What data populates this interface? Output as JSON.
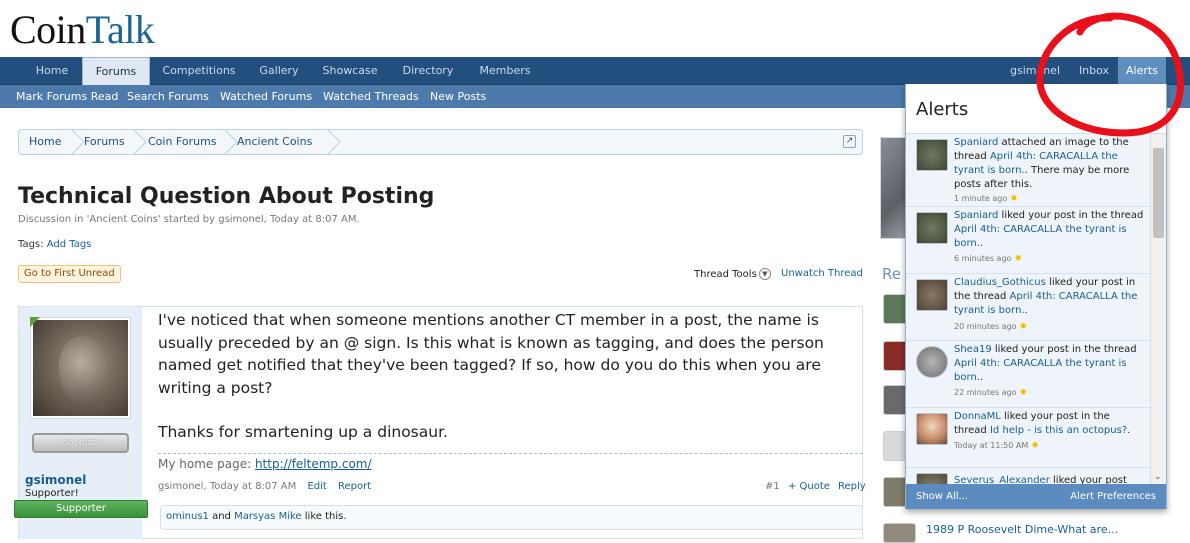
{
  "logo": {
    "part1": "Coin",
    "part2": "Talk"
  },
  "nav": {
    "tabs": [
      "Home",
      "Forums",
      "Competitions",
      "Gallery",
      "Showcase",
      "Directory",
      "Members"
    ],
    "user": "gsimonel",
    "inbox": "Inbox",
    "alerts": "Alerts"
  },
  "subnav": [
    "Mark Forums Read",
    "Search Forums",
    "Watched Forums",
    "Watched Threads",
    "New Posts"
  ],
  "breadcrumb": [
    "Home",
    "Forums",
    "Coin Forums",
    "Ancient Coins"
  ],
  "thread": {
    "title": "Technical Question About Posting",
    "description": "Discussion in 'Ancient Coins' started by gsimonel, Today at 8:07 AM.",
    "tags_label": "Tags:",
    "tags_link": "Add Tags",
    "first_unread": "Go to First Unread",
    "thread_tools": "Thread Tools",
    "unwatch": "Unwatch Thread"
  },
  "post": {
    "mood": "NO MOOD",
    "username": "gsimonel",
    "user_title": "Supporter!",
    "badge": "Supporter",
    "body1": "I've noticed that when someone mentions another CT member in a post, the name is usually preceded by an @ sign. Is this what is known as tagging, and does the person named get notified that they've been tagged? If so, how do you do this when you are writing a post?",
    "body2": "Thanks for smartening up a dinosaur.",
    "homepage_label": "My home page: ",
    "homepage_url": "http://feltemp.com/",
    "meta": "gsimonel, Today at 8:07 AM",
    "edit": "Edit",
    "report": "Report",
    "number": "#1",
    "quote": "+ Quote",
    "reply": "Reply",
    "likes_user1": "ominus1",
    "likes_and": " and ",
    "likes_user2": "Marsyas Mike",
    "likes_suffix": " like this."
  },
  "sidebar": {
    "heading": "Re",
    "last_item": "1989 P Roosevelt Dime-What are..."
  },
  "alerts_popup": {
    "title": "Alerts",
    "items": [
      {
        "user": "Spaniard",
        "action": " attached an image to the thread ",
        "thread": "April 4th: CARACALLA the tyrant is born.",
        "extra": ". There may be more posts after this.",
        "time": "1 minute ago"
      },
      {
        "user": "Spaniard",
        "action": " liked your post in the thread ",
        "thread": "April 4th: CARACALLA the tyrant is born.",
        "extra": ".",
        "time": "6 minutes ago"
      },
      {
        "user": "Claudius_Gothicus",
        "action": " liked your post in the thread ",
        "thread": "April 4th: CARACALLA the tyrant is born.",
        "extra": ".",
        "time": "20 minutes ago"
      },
      {
        "user": "Shea19",
        "action": " liked your post in the thread ",
        "thread": "April 4th: CARACALLA the tyrant is born.",
        "extra": ".",
        "time": "22 minutes ago"
      },
      {
        "user": "DonnaML",
        "action": " liked your post in the thread ",
        "thread": "Id help - is this an octopus?",
        "extra": ".",
        "time": "Today at 11:50 AM"
      },
      {
        "user": "Severus_Alexander",
        "action": " liked your post",
        "thread": "",
        "extra": "",
        "time": ""
      }
    ],
    "show_all": "Show All...",
    "preferences": "Alert Preferences"
  },
  "colors": {
    "nav": "#234f7e",
    "subnav": "#4d7aaa",
    "link": "#176093",
    "annotation": "#e8101b"
  }
}
